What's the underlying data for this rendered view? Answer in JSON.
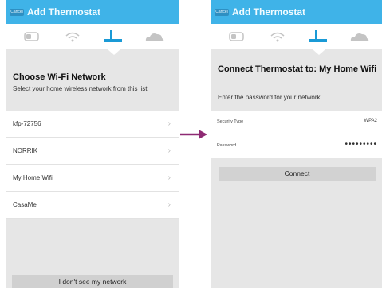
{
  "colors": {
    "header": "#3fb3e8",
    "accent": "#1a9ad6",
    "arrow": "#8e2a73",
    "inactive": "#c4c4c4"
  },
  "left": {
    "cancel_label": "Cancel",
    "title": "Add Thermostat",
    "steps": [
      "thermostat-icon",
      "wifi-icon",
      "router-icon",
      "cloud-icon"
    ],
    "active_step": 3,
    "section_title": "Choose Wi-Fi Network",
    "section_sub": "Select your home wireless network from this list:",
    "networks": [
      "kfp-72756",
      "NORRIK",
      "My Home Wifi",
      "CasaMe"
    ],
    "bottom_button": "I don't see my network"
  },
  "right": {
    "cancel_label": "Cancel",
    "title": "Add Thermostat",
    "steps": [
      "thermostat-icon",
      "wifi-icon",
      "router-icon",
      "cloud-icon"
    ],
    "active_step": 3,
    "section_title": "Connect Thermostat to: My Home Wifi",
    "section_sub": "Enter the password for your network:",
    "security_label": "Security Type",
    "security_value": "WPA2",
    "password_label": "Password",
    "password_value": "•••••••••",
    "connect_button": "Connect"
  }
}
